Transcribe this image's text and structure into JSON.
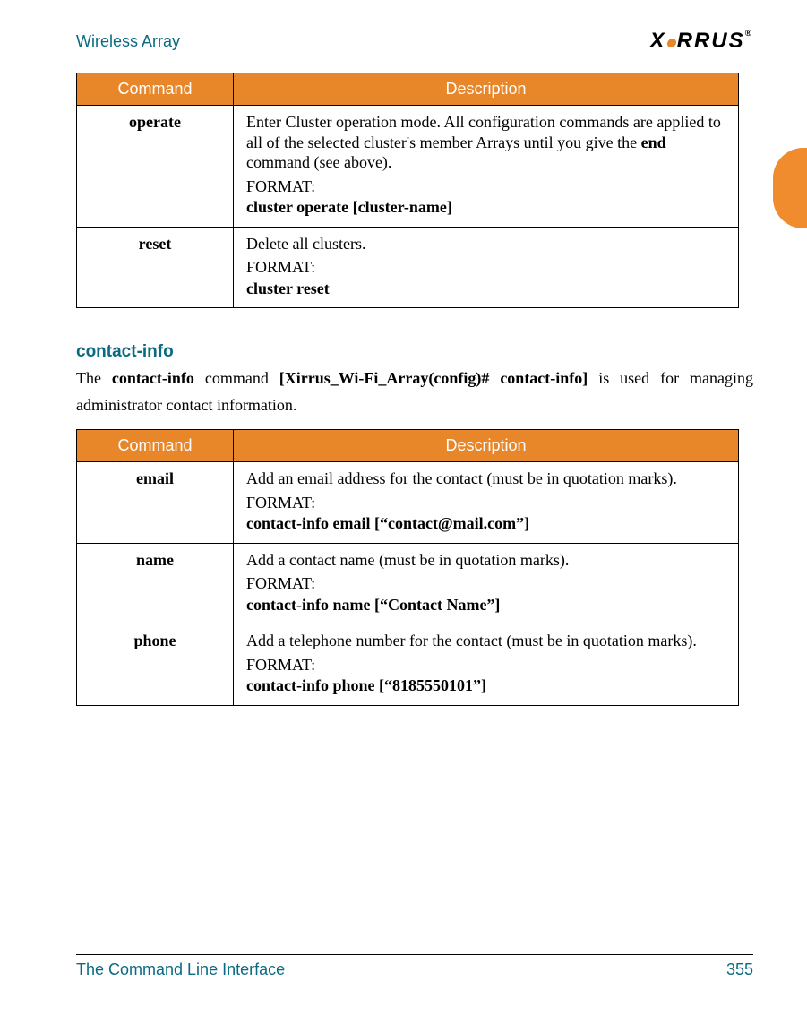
{
  "header": {
    "title": "Wireless Array",
    "logo_text": "XIRRUS"
  },
  "table1": {
    "headers": {
      "command": "Command",
      "description": "Description"
    },
    "rows": [
      {
        "command": "operate",
        "desc_pre": "Enter Cluster operation mode. All configuration commands are applied to all of the selected cluster's member Arrays until you give the ",
        "desc_bold": "end",
        "desc_post": " command (see above).",
        "format_label": "FORMAT:",
        "format_value": "cluster operate [cluster-name]"
      },
      {
        "command": "reset",
        "desc_pre": "Delete all clusters.",
        "desc_bold": "",
        "desc_post": "",
        "format_label": "FORMAT:",
        "format_value": "cluster reset"
      }
    ]
  },
  "section": {
    "heading": "contact-info",
    "intro_pre": "The ",
    "intro_b1": "contact-info",
    "intro_mid1": " command ",
    "intro_b2": "[Xirrus_Wi-Fi_Array(config)# contact-info]",
    "intro_post": " is used for managing administrator contact information."
  },
  "table2": {
    "headers": {
      "command": "Command",
      "description": "Description"
    },
    "rows": [
      {
        "command": "email",
        "desc": "Add an email address for the contact (must be in quotation marks).",
        "format_label": "FORMAT:",
        "format_value": "contact-info email [“contact@mail.com”]"
      },
      {
        "command": "name",
        "desc": "Add a contact name (must be in quotation marks).",
        "format_label": "FORMAT:",
        "format_value": "contact-info name [“Contact Name”]"
      },
      {
        "command": "phone",
        "desc": "Add a telephone number for the contact (must be in quotation marks).",
        "format_label": "FORMAT:",
        "format_value": "contact-info phone [“8185550101”]"
      }
    ]
  },
  "footer": {
    "section_title": "The Command Line Interface",
    "page_number": "355"
  }
}
